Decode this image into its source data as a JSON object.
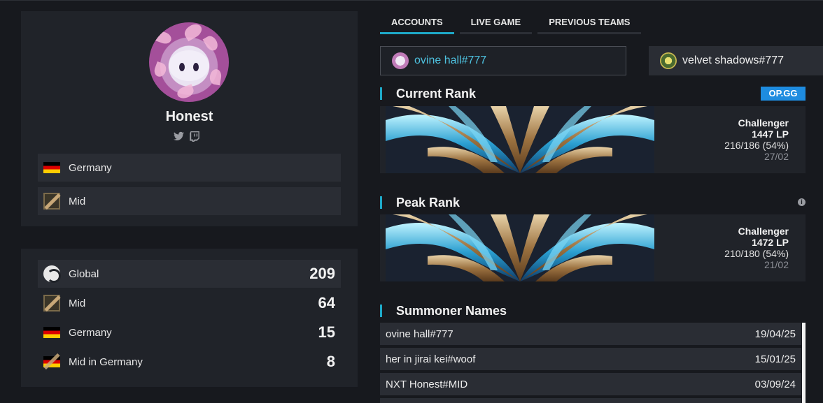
{
  "profile": {
    "name": "Honest",
    "country": "Germany",
    "role": "Mid",
    "social_icons": [
      "twitter-icon",
      "twitch-icon"
    ]
  },
  "rankings": [
    {
      "label": "Global",
      "value": "209",
      "icon": "globe-icon"
    },
    {
      "label": "Mid",
      "value": "64",
      "icon": "mid-role-icon"
    },
    {
      "label": "Germany",
      "value": "15",
      "icon": "germany-flag-icon"
    },
    {
      "label": "Mid in Germany",
      "value": "8",
      "icon": "mid-germany-icon"
    }
  ],
  "tabs": [
    "ACCOUNTS",
    "LIVE GAME",
    "PREVIOUS TEAMS"
  ],
  "active_tab": "ACCOUNTS",
  "accounts": [
    "ovine hall#777",
    "velvet shadows#777"
  ],
  "current_rank": {
    "title": "Current Rank",
    "badge": "OP.GG",
    "tier": "Challenger",
    "lp": "1447 LP",
    "record": "216/186 (54%)",
    "date": "27/02"
  },
  "peak_rank": {
    "title": "Peak Rank",
    "tier": "Challenger",
    "lp": "1472 LP",
    "record": "210/180 (54%)",
    "date": "21/02"
  },
  "summoner_names": {
    "title": "Summoner Names",
    "rows": [
      {
        "name": "ovine hall#777",
        "date": "19/04/25"
      },
      {
        "name": "her in jirai kei#woof",
        "date": "15/01/25"
      },
      {
        "name": "NXT Honest#MID",
        "date": "03/09/24"
      }
    ]
  },
  "colors": {
    "accent": "#1ea9c8",
    "link": "#4ec2e0",
    "opgg": "#1e8ce0",
    "panel": "#202329",
    "row": "#2a2d34"
  }
}
